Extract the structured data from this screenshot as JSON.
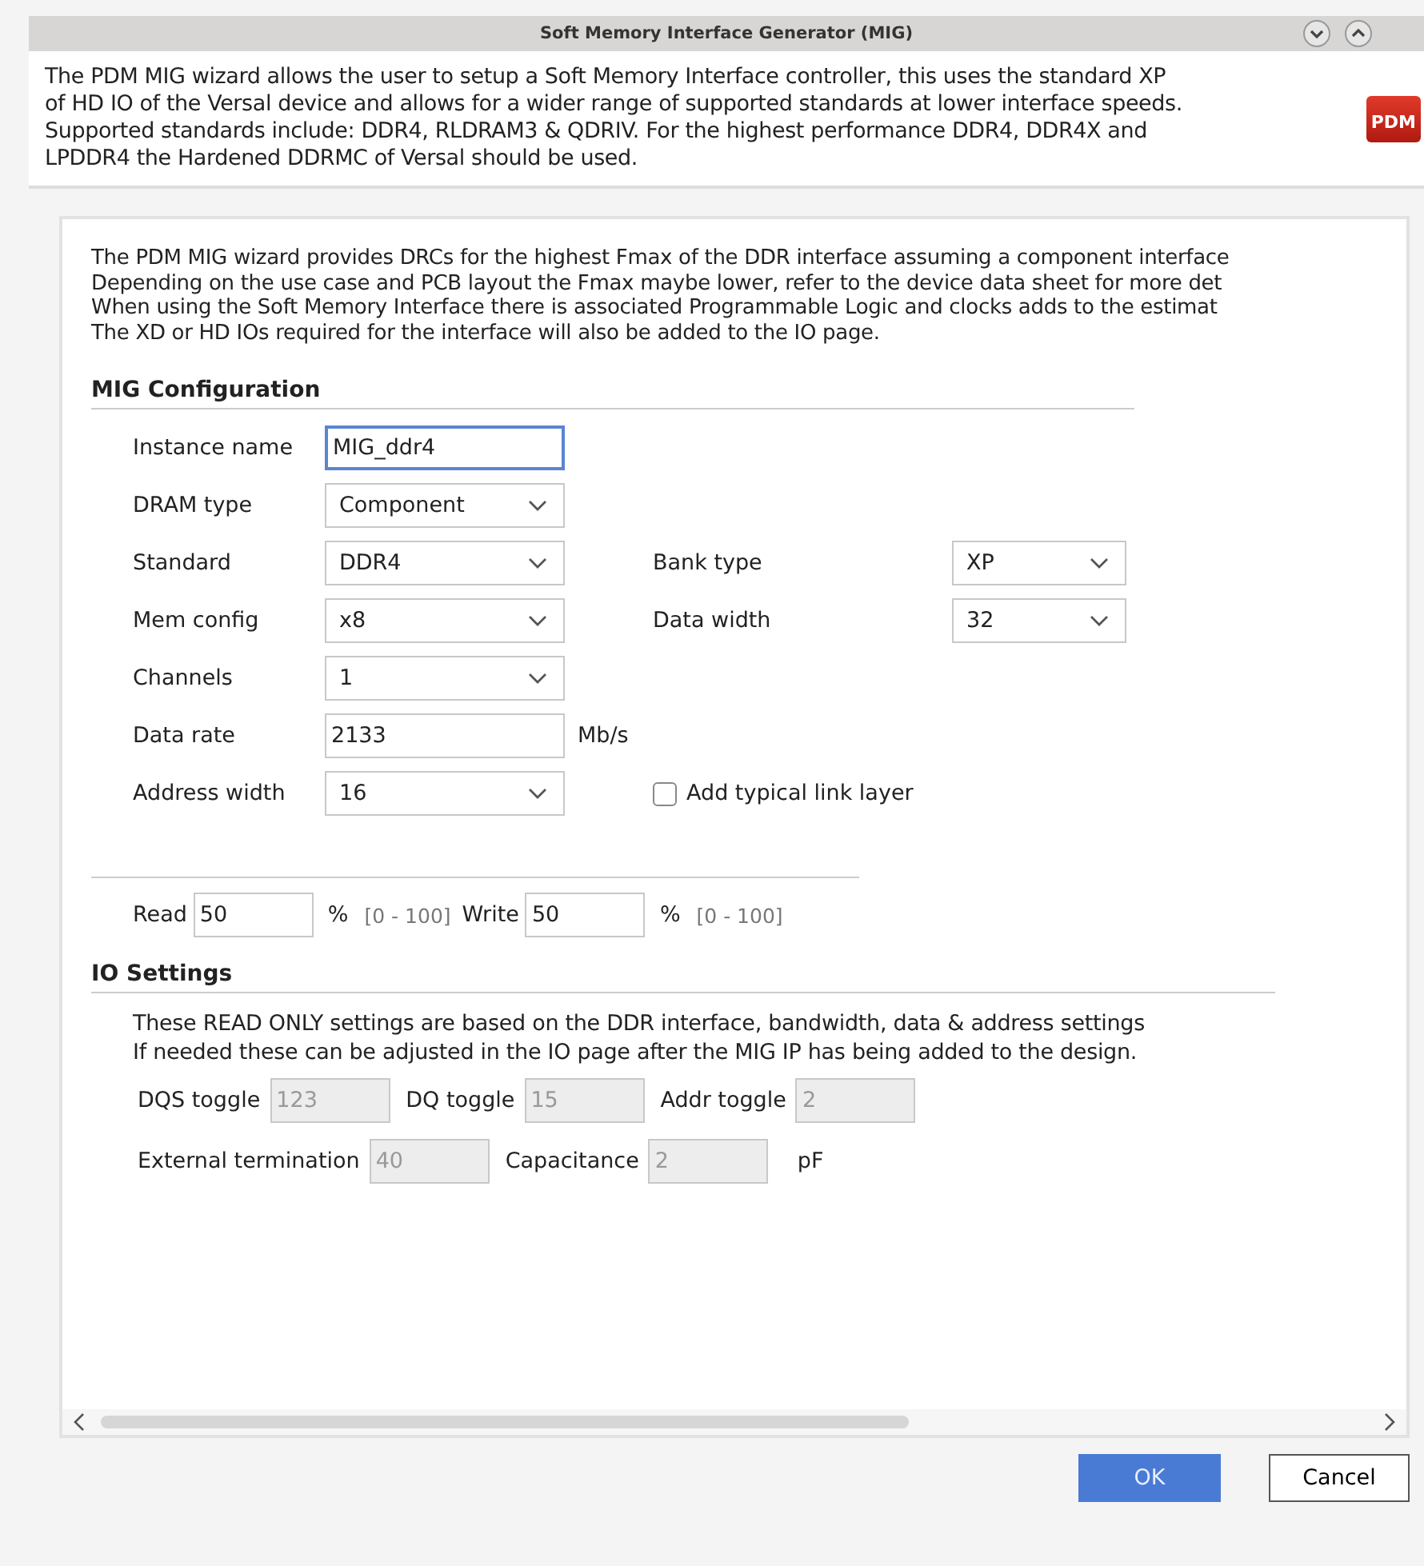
{
  "window": {
    "title": "Soft Memory Interface Generator (MIG)"
  },
  "header": {
    "text": "The PDM MIG wizard allows the user to setup a Soft Memory Interface controller, this uses the standard XP\nof HD IO of the Versal device and allows for a wider range of supported standards at lower interface speeds.\nSupported standards include: DDR4, RLDRAM3 & QDRIV. For the highest performance DDR4, DDR4X and\nLPDDR4 the Hardened DDRMC of Versal should be used.",
    "logo": "PDM"
  },
  "intro": "The PDM MIG wizard provides DRCs for the highest Fmax of the DDR interface assuming a component interface\nDepending on the use case and PCB layout the Fmax maybe lower, refer to the device data sheet for more det\nWhen using the Soft Memory Interface there is associated Programmable Logic and clocks adds to the estimat\nThe XD or HD IOs required for the interface will also be added to the IO page.",
  "mig_configuration": {
    "title": "MIG Configuration",
    "rows": [
      {
        "label": "Instance name",
        "field": {
          "kind": "text",
          "value": "MIG_ddr4",
          "focused": true
        }
      },
      {
        "label": "DRAM type",
        "field": {
          "kind": "combo",
          "value": "Component"
        }
      },
      {
        "label": "Standard",
        "field": {
          "kind": "combo",
          "value": "DDR4"
        },
        "right": {
          "kind": "combo",
          "label": "Bank type",
          "value": "XP"
        }
      },
      {
        "label": "Mem config",
        "field": {
          "kind": "combo",
          "value": "x8"
        },
        "right": {
          "kind": "combo",
          "label": "Data width",
          "value": "32"
        }
      },
      {
        "label": "Channels",
        "field": {
          "kind": "combo",
          "value": "1"
        }
      },
      {
        "label": "Data rate",
        "field": {
          "kind": "text",
          "value": "2133",
          "focused": false
        },
        "unit": "Mb/s"
      },
      {
        "label": "Address width",
        "field": {
          "kind": "combo",
          "value": "16"
        },
        "right": {
          "kind": "checkbox",
          "label": "Add typical link layer",
          "checked": false
        }
      }
    ]
  },
  "ratio": [
    {
      "label": "Read",
      "value": "50",
      "unit": "%",
      "range": "[0 - 100]"
    },
    {
      "label": "Write",
      "value": "50",
      "unit": "%",
      "range": "[0 - 100]"
    }
  ],
  "io_settings": {
    "title": "IO Settings",
    "note": "These READ ONLY settings are based on the DDR interface, bandwidth, data & address settings\nIf needed these can be adjusted in the IO page after the MIG IP has being added to the design.",
    "rows": [
      [
        {
          "label": "DQS toggle",
          "value": "123",
          "disabled": true
        },
        {
          "label": "DQ toggle",
          "value": "15",
          "disabled": true
        },
        {
          "label": "Addr toggle",
          "value": "2",
          "disabled": true
        }
      ],
      [
        {
          "label": "External termination",
          "value": "40",
          "disabled": true
        },
        {
          "label": "Capacitance",
          "value": "2",
          "unit": "pF",
          "disabled": true
        }
      ]
    ]
  },
  "buttons": [
    {
      "label": "OK",
      "kind": "primary"
    },
    {
      "label": "Cancel",
      "kind": "secondary"
    }
  ]
}
